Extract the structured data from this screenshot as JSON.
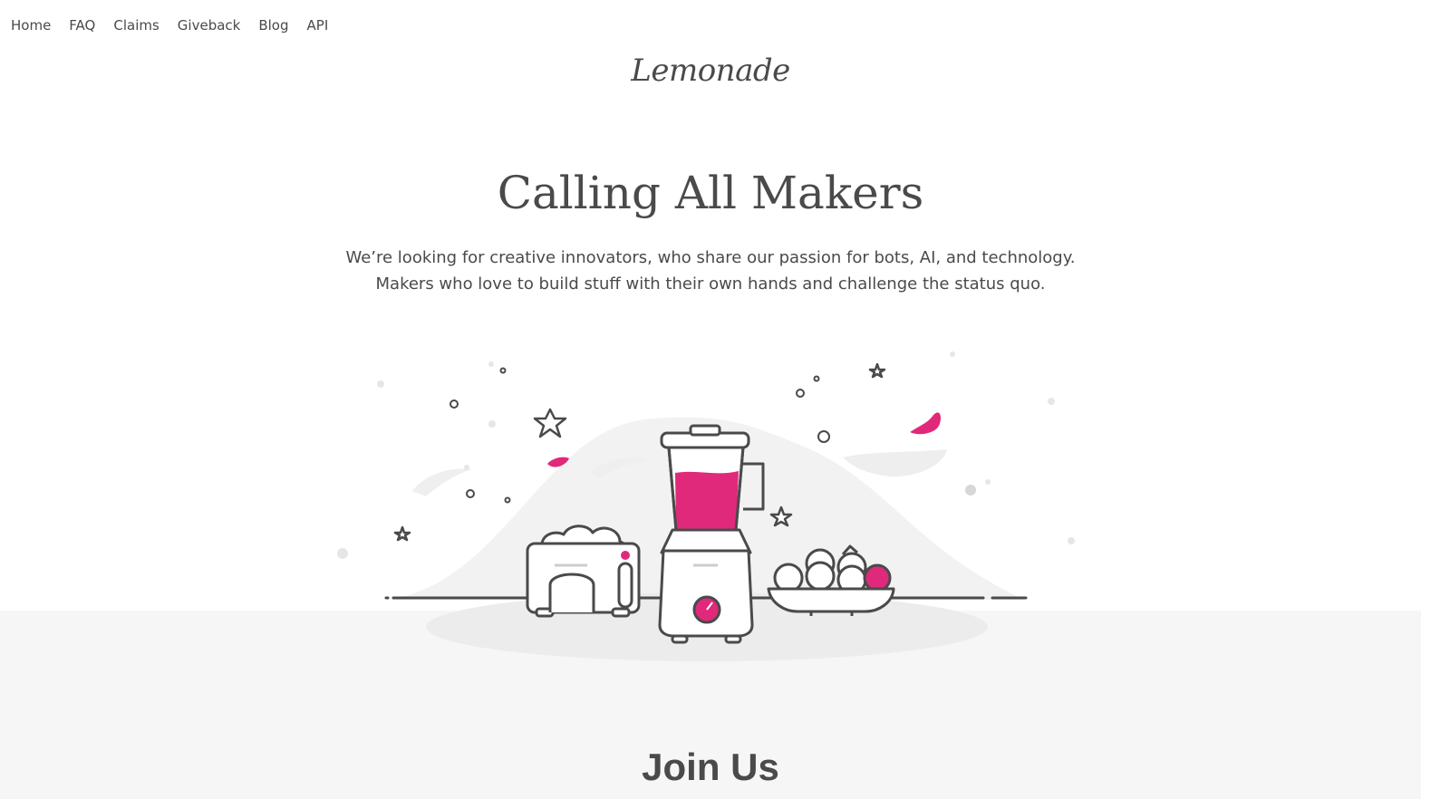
{
  "nav": {
    "items": [
      {
        "label": "Home"
      },
      {
        "label": "FAQ"
      },
      {
        "label": "Claims"
      },
      {
        "label": "Giveback"
      },
      {
        "label": "Blog"
      },
      {
        "label": "API"
      }
    ]
  },
  "brand": {
    "logo_text": "Lemonade"
  },
  "hero": {
    "title": "Calling All Makers",
    "subtitle_line1": "We’re looking for creative innovators, who share our passion for bots, AI, and technology.",
    "subtitle_line2": "Makers who love to build stuff with their own hands and challenge the status quo."
  },
  "illustration": {
    "icons": [
      "toaster-icon",
      "blender-icon",
      "fruit-bowl-icon",
      "sparkle-icon",
      "splash-icon"
    ],
    "accent_color": "#e0297a",
    "line_color": "#4a4a4a"
  },
  "join": {
    "title": "Join Us"
  },
  "colors": {
    "background": "#ffffff",
    "band": "#f6f6f6",
    "text": "#4a4a4a",
    "accent": "#e0297a"
  }
}
